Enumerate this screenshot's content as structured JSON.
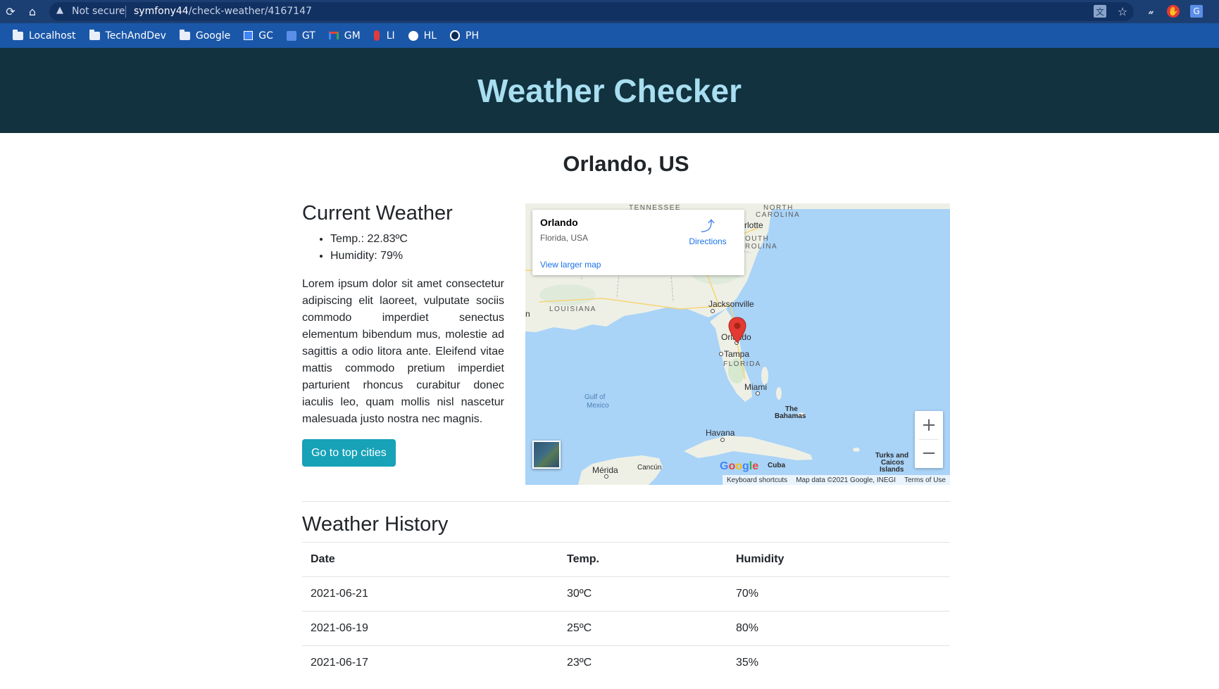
{
  "browser": {
    "security_label": "Not secure",
    "url_host": "symfony44",
    "url_path": "/check-weather/4167147",
    "bookmarks": [
      {
        "label": "Localhost",
        "icon": "folder-icon"
      },
      {
        "label": "TechAndDev",
        "icon": "folder-icon"
      },
      {
        "label": "Google",
        "icon": "folder-icon"
      },
      {
        "label": "GC",
        "icon": "google-calendar-icon"
      },
      {
        "label": "GT",
        "icon": "google-translate-icon"
      },
      {
        "label": "GM",
        "icon": "gmail-icon"
      },
      {
        "label": "LI",
        "icon": "bookmark-li-icon"
      },
      {
        "label": "HL",
        "icon": "globe-icon"
      },
      {
        "label": "PH",
        "icon": "bookmark-ph-icon"
      }
    ]
  },
  "header": {
    "title": "Weather Checker",
    "bg_color": "#12323f",
    "title_color": "#a8def0"
  },
  "city": "Orlando, US",
  "current": {
    "heading": "Current Weather",
    "temp": "Temp.: 22.83ºC",
    "humidity": "Humidity: 79%",
    "description": "Lorem ipsum dolor sit amet consectetur adipiscing elit laoreet, vulputate sociis commodo imperdiet senectus elementum bibendum mus, molestie ad sagittis a odio litora ante. Eleifend vitae mattis commodo pretium imperdiet parturient rhoncus curabitur donec iaculis leo, quam mollis nisl nascetur malesuada justo nostra nec magnis.",
    "button_label": "Go to top cities",
    "button_color": "#17a2b8"
  },
  "map": {
    "place_name": "Orlando",
    "place_address": "Florida, USA",
    "directions_label": "Directions",
    "larger_map_link": "View larger map",
    "logo_text": "Google",
    "attribution": {
      "shortcuts": "Keyboard shortcuts",
      "data": "Map data ©2021 Google, INEGI",
      "terms": "Terms of Use"
    },
    "labels": {
      "tennessee": "TENNESSEE",
      "north": "NORTH",
      "carolina_n": "CAROLINA",
      "charlotte": "rlotte",
      "south": "OUTH",
      "carolina_s": "ROLINA",
      "louisiana": "LOUISIANA",
      "jacksonville": "Jacksonville",
      "orlando": "Orlando",
      "tampa": "Tampa",
      "florida": "FLORIDA",
      "miami": "Miami",
      "gulf": "Gulf of",
      "mexico": "Mexico",
      "bahamas_1": "The",
      "bahamas_2": "Bahamas",
      "havana": "Havana",
      "cuba": "Cuba",
      "merida": "Mérida",
      "cancun": "Cancún",
      "turks_1": "Turks and",
      "turks_2": "Caicos",
      "turks_3": "Islands",
      "edge_n": "n"
    }
  },
  "history": {
    "heading": "Weather History",
    "columns": [
      "Date",
      "Temp.",
      "Humidity"
    ],
    "rows": [
      [
        "2021-06-21",
        "30ºC",
        "70%"
      ],
      [
        "2021-06-19",
        "25ºC",
        "80%"
      ],
      [
        "2021-06-17",
        "23ºC",
        "35%"
      ]
    ]
  }
}
